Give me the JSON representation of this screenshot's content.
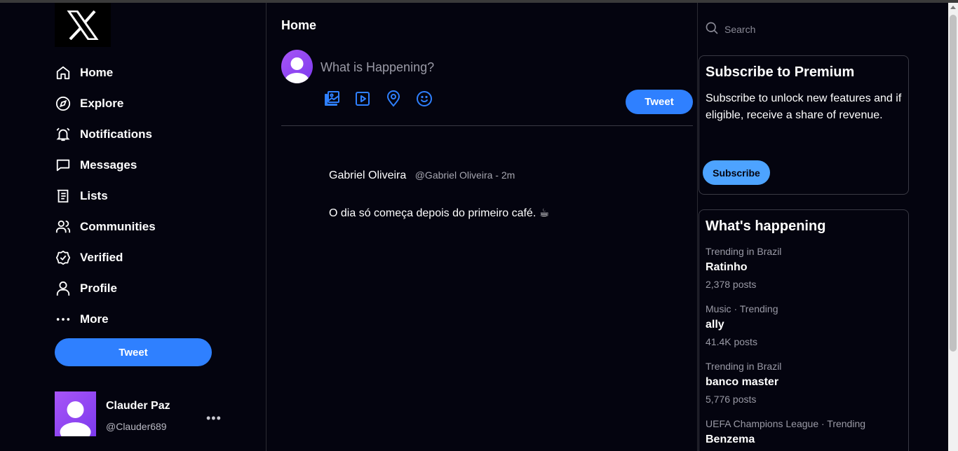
{
  "app": {
    "logo_icon": "x-logo-icon"
  },
  "sidebar": {
    "items": [
      {
        "label": "Home",
        "icon": "home-icon"
      },
      {
        "label": "Explore",
        "icon": "compass-icon"
      },
      {
        "label": "Notifications",
        "icon": "bell-icon"
      },
      {
        "label": "Messages",
        "icon": "message-icon"
      },
      {
        "label": "Lists",
        "icon": "list-icon"
      },
      {
        "label": "Communities",
        "icon": "users-icon"
      },
      {
        "label": "Verified",
        "icon": "verified-icon"
      },
      {
        "label": "Profile",
        "icon": "user-icon"
      },
      {
        "label": "More",
        "icon": "more-icon"
      }
    ],
    "tweet_label": "Tweet",
    "account": {
      "name": "Clauder Paz",
      "handle": "@Clauder689",
      "more": "•••"
    }
  },
  "main": {
    "title": "Home",
    "compose": {
      "placeholder": "What is Happening?",
      "tweet_label": "Tweet",
      "tools": [
        "image-icon",
        "video-icon",
        "location-icon",
        "emoji-icon"
      ]
    },
    "posts": [
      {
        "author": "Gabriel Oliveira",
        "meta": "@Gabriel Oliveira - 2m",
        "text": "O dia só começa depois do primeiro café. ☕"
      }
    ]
  },
  "right": {
    "search": {
      "placeholder": "Search"
    },
    "premium": {
      "title": "Subscribe to Premium",
      "description": "Subscribe to unlock new features and if eligible, receive a share of revenue.",
      "button": "Subscribe"
    },
    "trends": {
      "title": "What's happening",
      "items": [
        {
          "context": "Trending in Brazil",
          "name": "Ratinho",
          "count": "2,378 posts"
        },
        {
          "context": "Music · Trending",
          "name": "ally",
          "count": "41.4K posts"
        },
        {
          "context": "Trending in Brazil",
          "name": "banco master",
          "count": "5,776 posts"
        },
        {
          "context": "UEFA Champions League · Trending",
          "name": "Benzema",
          "count": ""
        }
      ]
    }
  },
  "colors": {
    "background": "#04040f",
    "accent": "#2f80ff",
    "subscribe": "#4da3ff",
    "avatar": "#a855f7"
  }
}
